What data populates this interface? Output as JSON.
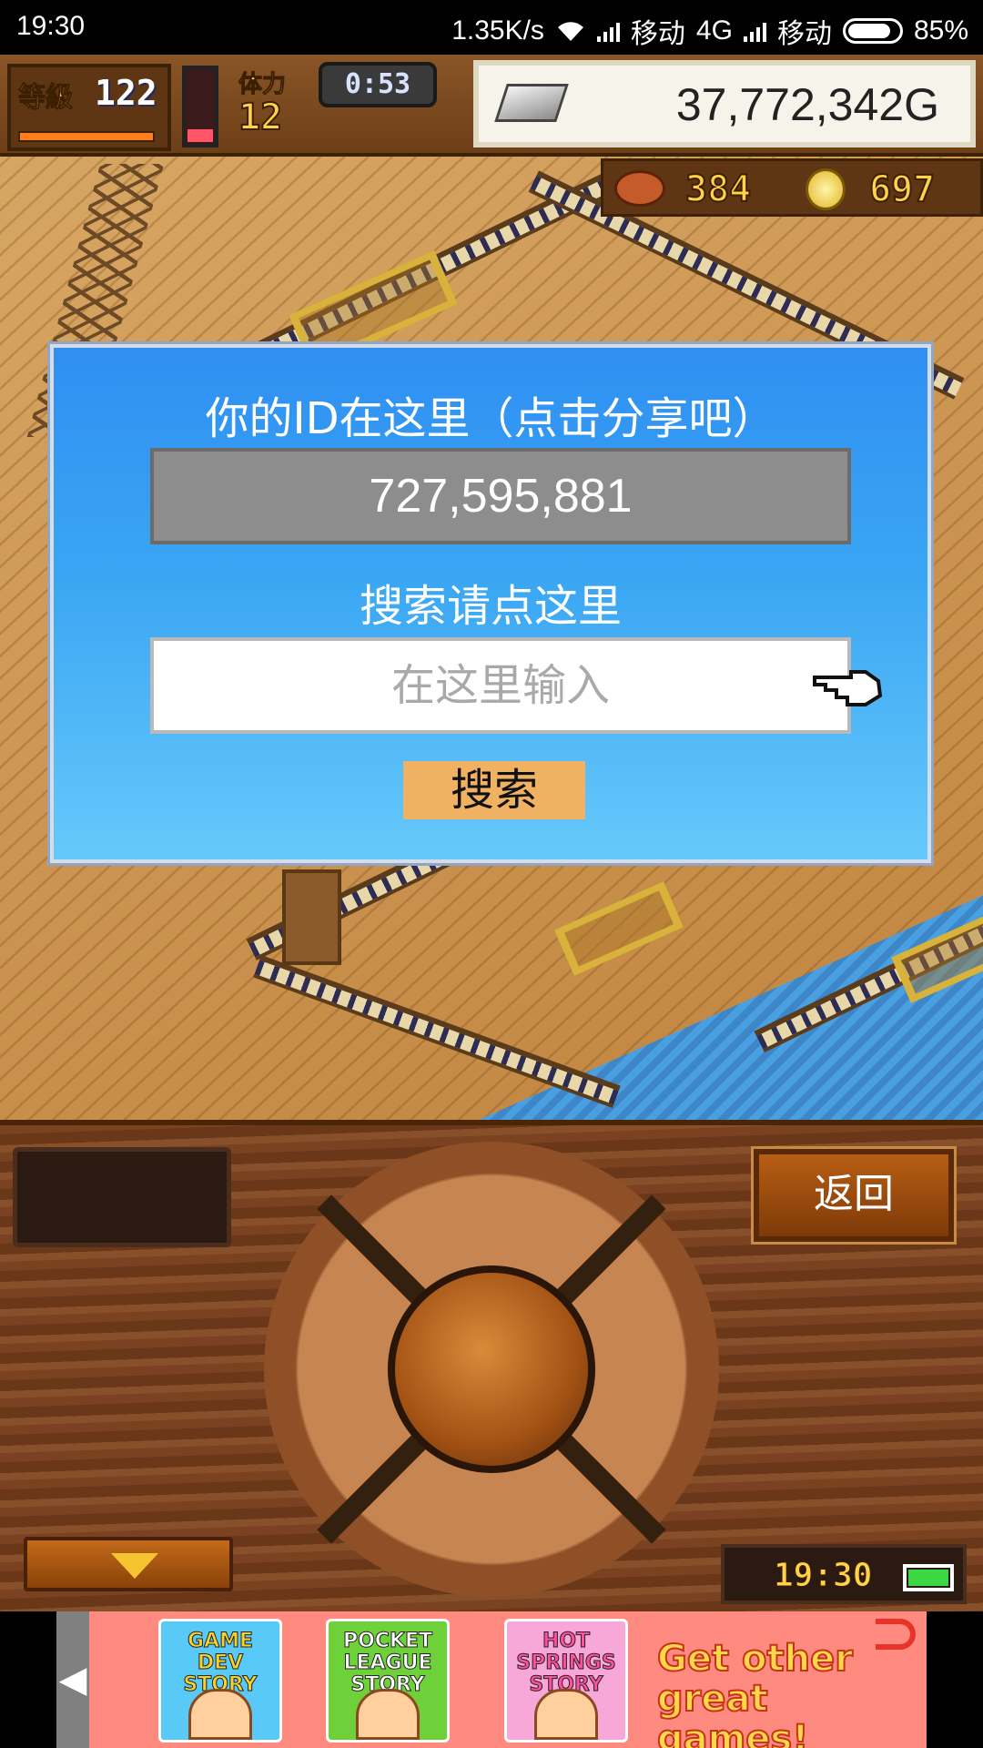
{
  "status_bar": {
    "time": "19:30",
    "network_speed": "1.35K/s",
    "carrier_1": "移动",
    "network_type": "4G",
    "carrier_2": "移动",
    "battery": "85%",
    "battery_level": 0.85
  },
  "hud": {
    "level_label": "等級",
    "level_value": "122",
    "stamina_label": "体力",
    "stamina_value": "12",
    "timer": "0:53",
    "money": "37,772,342G",
    "food": "384",
    "medals": "697"
  },
  "dialog": {
    "title": "你的ID在这里（点击分享吧）",
    "id_value": "727,595,881",
    "search_prompt": "搜索请点这里",
    "search_placeholder": "在这里输入",
    "search_button": "搜索"
  },
  "controller": {
    "back_button": "返回",
    "clock": "19:30"
  },
  "ad": {
    "tiles": [
      "GAME DEV STORY",
      "POCKET LEAGUE STORY",
      "HOT SPRINGS STORY"
    ],
    "cta": "Get other great games!"
  },
  "colors": {
    "dialog_top": "#2f8ff2",
    "dialog_bottom": "#66c9fb",
    "search_button": "#f0b262",
    "id_box": "#8d8d8d",
    "ad_background": "#ff8a80"
  }
}
